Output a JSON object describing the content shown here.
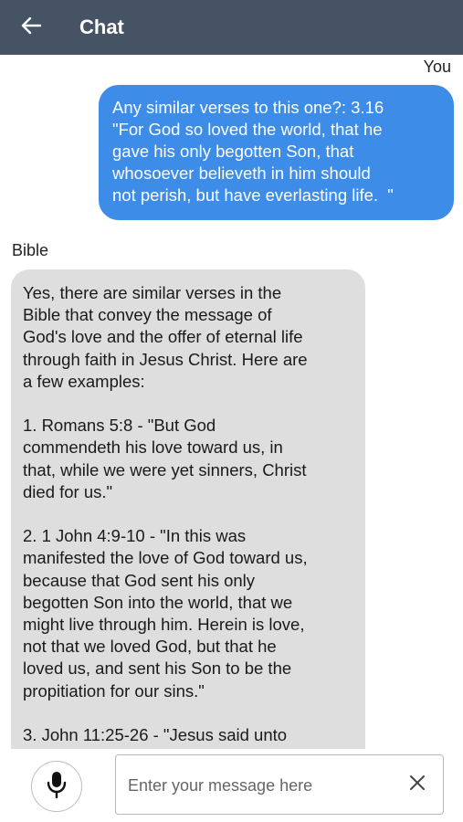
{
  "header": {
    "title": "Chat",
    "back_icon": "arrow-left-icon"
  },
  "colors": {
    "header_bg": "#465365",
    "user_bubble": "#3d8ce8",
    "bot_bubble": "#dedede"
  },
  "messages": [
    {
      "sender": "You",
      "text": "Any similar verses to this one?: 3.16\n\"For God so loved the world, that he\ngave his only begotten Son, that\nwhosoever believeth in him should\nnot perish, but have everlasting life.  \""
    },
    {
      "sender": "Bible",
      "text": "Yes, there are similar verses in the\nBible that convey the message of\nGod's love and the offer of eternal life\nthrough faith in Jesus Christ. Here are\na few examples:\n\n1. Romans 5:8 - \"But God\ncommendeth his love toward us, in\nthat, while we were yet sinners, Christ\ndied for us.\"\n\n2. 1 John 4:9-10 - \"In this was\nmanifested the love of God toward us,\nbecause that God sent his only\nbegotten Son into the world, that we\nmight live through him. Herein is love,\nnot that we loved God, but that he\nloved us, and sent his Son to be the\npropitiation for our sins.\"\n\n3. John 11:25-26 - \"Jesus said unto"
    }
  ],
  "composer": {
    "placeholder": "Enter your message here",
    "value": "",
    "mic_icon": "microphone-icon",
    "clear_icon": "close-icon"
  }
}
